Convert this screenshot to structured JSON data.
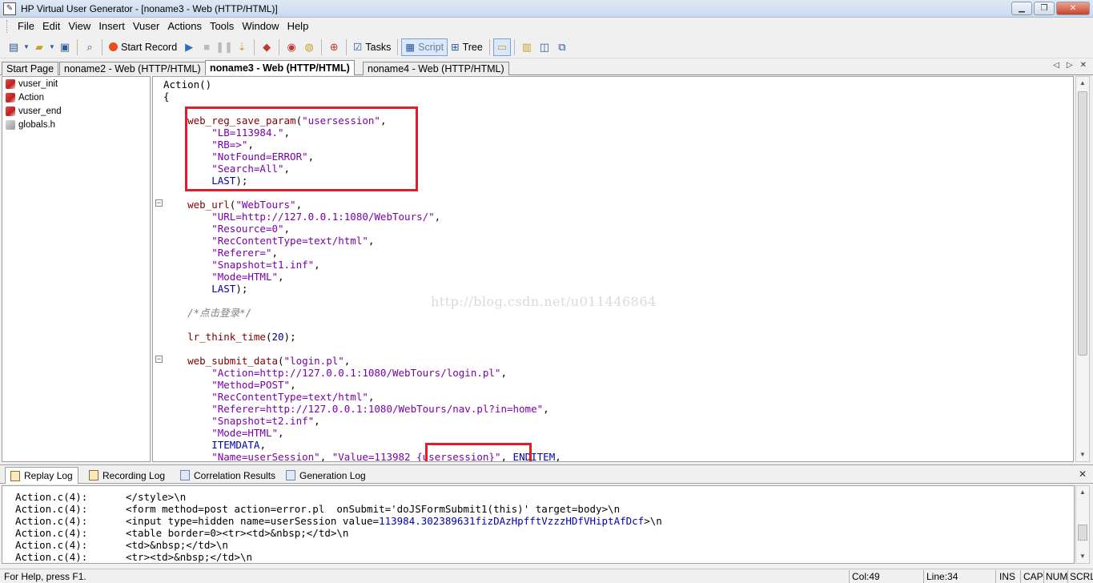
{
  "window": {
    "title": "HP Virtual User Generator - [noname3 - Web (HTTP/HTML)]",
    "icon": "pencil-app-icon",
    "controls": [
      "minimize",
      "restore",
      "close"
    ]
  },
  "menu": [
    {
      "label": "File",
      "hot": "F"
    },
    {
      "label": "Edit",
      "hot": "E"
    },
    {
      "label": "View",
      "hot": "V"
    },
    {
      "label": "Insert",
      "hot": "I"
    },
    {
      "label": "Vuser",
      "hot": "u"
    },
    {
      "label": "Actions",
      "hot": "A"
    },
    {
      "label": "Tools",
      "hot": "T"
    },
    {
      "label": "Window",
      "hot": "W"
    },
    {
      "label": "Help",
      "hot": "H"
    }
  ],
  "toolbar": {
    "start_record": "Start Record",
    "tasks": "Tasks",
    "script": "Script",
    "tree": "Tree"
  },
  "doc_tabs": [
    {
      "label": "Start Page",
      "active": false
    },
    {
      "label": "noname2 - Web (HTTP/HTML)",
      "active": false
    },
    {
      "label": "noname3 - Web (HTTP/HTML)",
      "active": true
    },
    {
      "label": "noname4 - Web (HTTP/HTML)",
      "active": false
    }
  ],
  "tree": [
    {
      "label": "vuser_init",
      "icon": "action-icon"
    },
    {
      "label": "Action",
      "icon": "action-icon"
    },
    {
      "label": "vuser_end",
      "icon": "action-icon"
    },
    {
      "label": "globals.h",
      "icon": "header-file-icon"
    }
  ],
  "code": {
    "l1": "Action()",
    "l2": "{",
    "reg_fn": "web_reg_save_param",
    "reg_a1": "\"usersession\"",
    "reg_a2": "\"LB=113984.\"",
    "reg_a3": "\"RB=>\"",
    "reg_a4": "\"NotFound=ERROR\"",
    "reg_a5": "\"Search=All\"",
    "last": "LAST",
    "url_fn": "web_url",
    "url_a1": "\"WebTours\"",
    "url_a2": "\"URL=http://127.0.0.1:1080/WebTours/\"",
    "url_a3": "\"Resource=0\"",
    "url_a4": "\"RecContentType=text/html\"",
    "url_a5": "\"Referer=\"",
    "url_a6": "\"Snapshot=t1.inf\"",
    "url_a7": "\"Mode=HTML\"",
    "comment": "/*点击登录*/",
    "think_fn": "lr_think_time",
    "think_val": "20",
    "sub_fn": "web_submit_data",
    "sub_a1": "\"login.pl\"",
    "sub_a2": "\"Action=http://127.0.0.1:1080/WebTours/login.pl\"",
    "sub_a3": "\"Method=POST\"",
    "sub_a4": "\"RecContentType=text/html\"",
    "sub_a5": "\"Referer=http://127.0.0.1:1080/WebTours/nav.pl?in=home\"",
    "sub_a6": "\"Snapshot=t2.inf\"",
    "sub_a7": "\"Mode=HTML\"",
    "itemdata": "ITEMDATA",
    "sub_a8": "\"Name=userSession\"",
    "sub_a9_pre": "\"Value=113982 ",
    "sub_a9_param": "{usersession}",
    "sub_a9_post": "\"",
    "enditem": "ENDITEM"
  },
  "watermark": "http://blog.csdn.net/u011446864",
  "bottom_tabs": [
    {
      "label": "Replay Log",
      "active": true
    },
    {
      "label": "Recording Log",
      "active": false
    },
    {
      "label": "Correlation Results",
      "active": false
    },
    {
      "label": "Generation Log",
      "active": false
    }
  ],
  "log_lines": [
    {
      "src": "Action.c(4):",
      "text": "</style>\\n"
    },
    {
      "src": "Action.c(4):",
      "text": "<form method=post action=error.pl  onSubmit='doJSFormSubmit1(this)' target=body>\\n"
    },
    {
      "src": "Action.c(4):",
      "text": "<input type=hidden name=userSession value=",
      "value": "113984.302389631fizDAzHpfftVzzzHDfVHiptAfDcf",
      "tail": ">\\n"
    },
    {
      "src": "Action.c(4):",
      "text": "<table border=0><tr><td>&nbsp;</td>\\n"
    },
    {
      "src": "Action.c(4):",
      "text": "<td>&nbsp;</td>\\n"
    },
    {
      "src": "Action.c(4):",
      "text": "<tr><td>&nbsp;</td>\\n"
    }
  ],
  "status": {
    "help": "For Help, press F1.",
    "col": "Col:49",
    "line": "Line:34",
    "ins": "INS",
    "cap": "CAP",
    "num": "NUM",
    "scrl": "SCRL"
  }
}
